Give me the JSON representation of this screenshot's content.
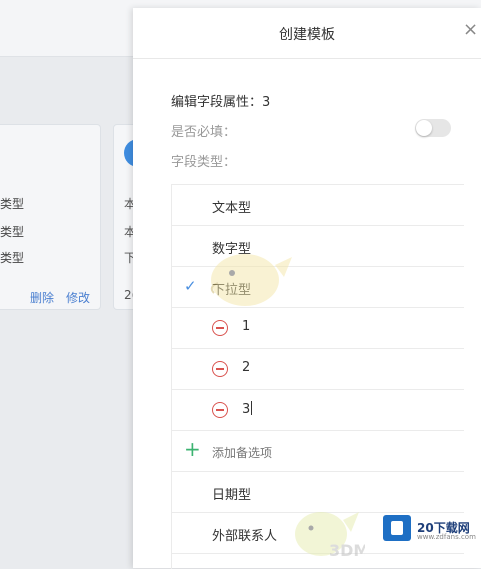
{
  "background": {
    "card_rows": [
      "类型",
      "类型",
      "类型"
    ],
    "card_actions": {
      "delete": "删除",
      "edit": "修改"
    },
    "card2_rows": [
      "本",
      "本",
      "下",
      "2("
    ]
  },
  "panel": {
    "title": "创建模板",
    "close_icon": "×",
    "field_attr_label": "编辑字段属性：3",
    "required_label": "是否必填：",
    "required_on": false,
    "type_label": "字段类型：",
    "types": {
      "text": "文本型",
      "number": "数字型",
      "dropdown": "下拉型",
      "date": "日期型",
      "contact": "外部联系人"
    },
    "selected_type": "下拉型",
    "check_icon": "✓",
    "dropdown_options": [
      "1",
      "2",
      "3"
    ],
    "add_option_label": "添加备选项",
    "add_icon": "+"
  },
  "watermark": {
    "brand": "20下载网",
    "url": "www.zdfans.com",
    "text_3dm": "3DM"
  },
  "colors": {
    "accent": "#4a8fe0",
    "danger": "#d9534f",
    "add": "#3cb371"
  }
}
